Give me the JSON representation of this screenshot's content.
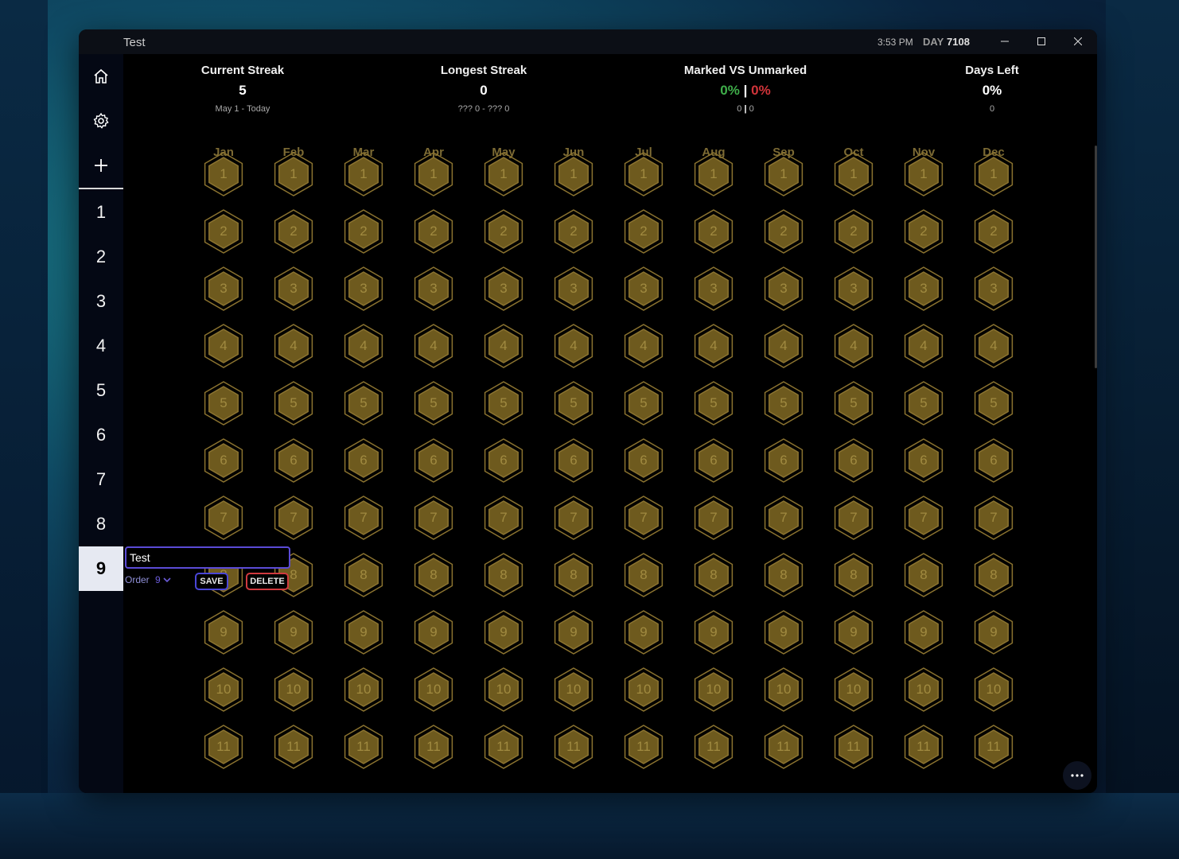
{
  "window": {
    "title": "Test",
    "clock": "3:53 PM",
    "day_word": "DAY",
    "day_number": "7108",
    "minimize_icon": "minimize-icon",
    "maximize_icon": "maximize-icon",
    "close_icon": "close-icon"
  },
  "sidebar": {
    "icons": [
      "home-icon",
      "gear-icon",
      "plus-icon"
    ],
    "items": [
      "1",
      "2",
      "3",
      "4",
      "5",
      "6",
      "7",
      "8",
      "9"
    ],
    "selected": "9"
  },
  "stats": {
    "current_streak": {
      "label": "Current Streak",
      "value": "5",
      "sub": "May 1 - Today"
    },
    "longest_streak": {
      "label": "Longest Streak",
      "value": "0",
      "sub": "??? 0 - ??? 0"
    },
    "marked_vs_unmarked": {
      "label": "Marked VS Unmarked",
      "marked_pct": "0%",
      "separator": "|",
      "unmarked_pct": "0%",
      "marked_count": "0",
      "count_separator": "|",
      "unmarked_count": "0"
    },
    "days_left": {
      "label": "Days Left",
      "value": "0%",
      "sub": "0"
    }
  },
  "months": [
    "Jan",
    "Feb",
    "Mar",
    "Apr",
    "May",
    "Jun",
    "Jul",
    "Aug",
    "Sep",
    "Oct",
    "Nov",
    "Dec"
  ],
  "days": [
    "1",
    "2",
    "3",
    "4",
    "5",
    "6",
    "7",
    "8",
    "9",
    "10",
    "11"
  ],
  "editor": {
    "name_value": "Test",
    "order_label": "Order",
    "order_value": "9",
    "save_label": "SAVE",
    "delete_label": "DELETE"
  },
  "colors": {
    "hex_fill": "#6e5a1e",
    "hex_stroke": "#8c7430",
    "month_text": "#7d6b34",
    "accent_purple": "#5b4bd6",
    "danger_red": "#d13a3f",
    "positive_green": "#3fae4a"
  },
  "more_button": {
    "label": "···",
    "icon": "more-icon"
  }
}
